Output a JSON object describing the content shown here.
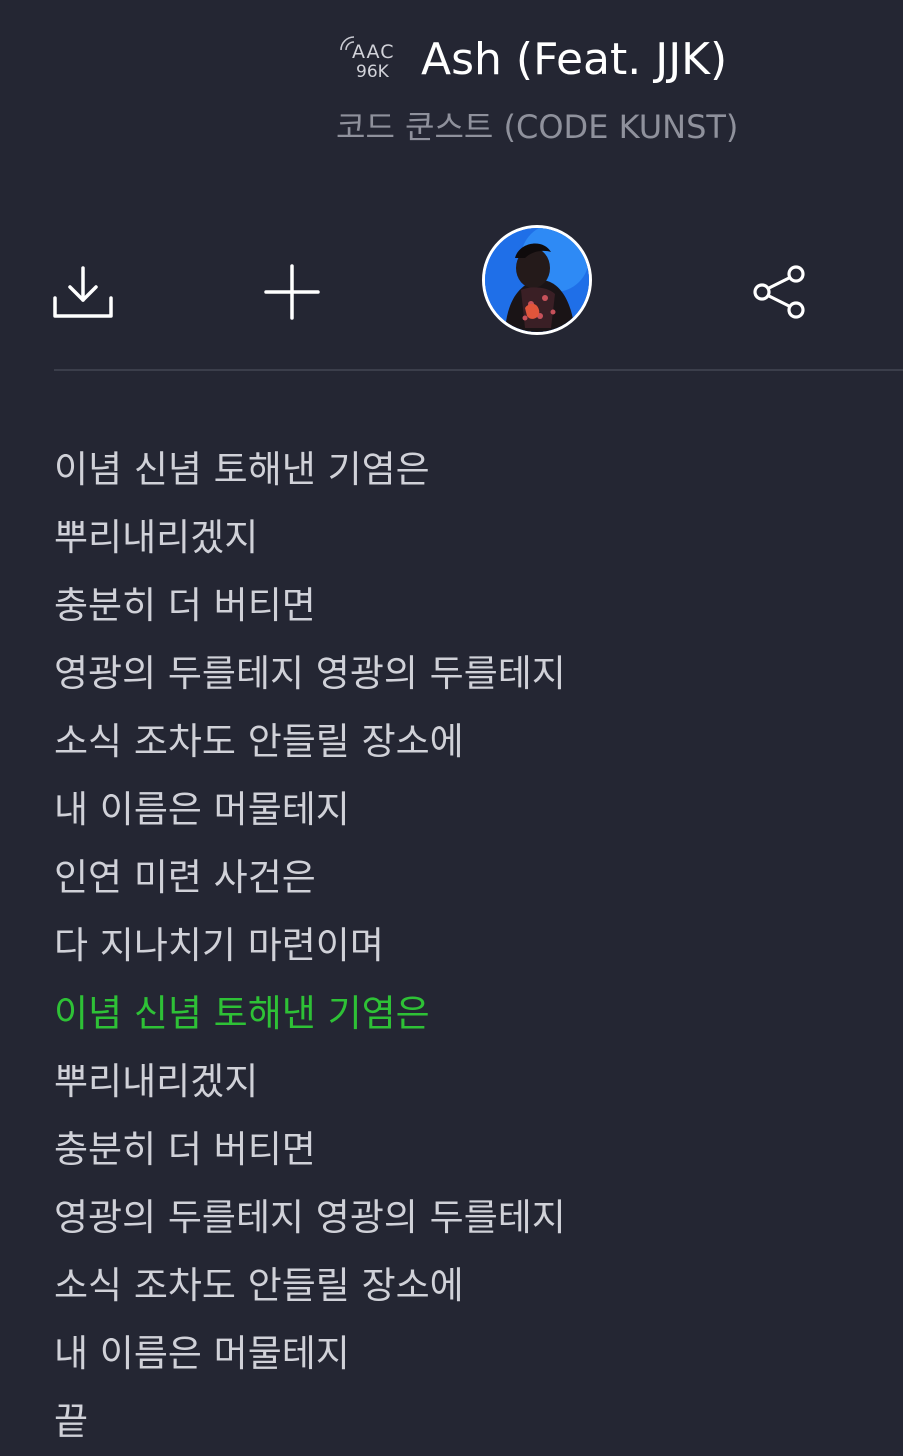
{
  "track": {
    "codec": "AAC",
    "bitrate": "96K",
    "title": "Ash (Feat. JJK)",
    "artist": "코드 쿤스트 (CODE KUNST)"
  },
  "icons": {
    "quality_wave": "signal-wave-icon",
    "download": "download-icon",
    "add": "plus-icon",
    "share": "share-icon"
  },
  "colors": {
    "background": "#242633",
    "title": "#ffffff",
    "artist": "#8f919c",
    "lyric": "#d0d1d8",
    "highlight": "#2ec136"
  },
  "lyrics": {
    "current_index": 8,
    "lines": [
      "이념 신념 토해낸 기염은",
      "뿌리내리겠지",
      "충분히 더 버티면",
      "영광의 두를테지 영광의 두를테지",
      "소식 조차도 안들릴 장소에",
      "내 이름은 머물테지",
      "인연 미련 사건은",
      "다 지나치기 마련이며",
      "이념 신념 토해낸 기염은",
      "뿌리내리겠지",
      "충분히 더 버티면",
      "영광의 두를테지 영광의 두를테지",
      "소식 조차도 안들릴 장소에",
      "내 이름은 머물테지",
      "끝"
    ]
  }
}
